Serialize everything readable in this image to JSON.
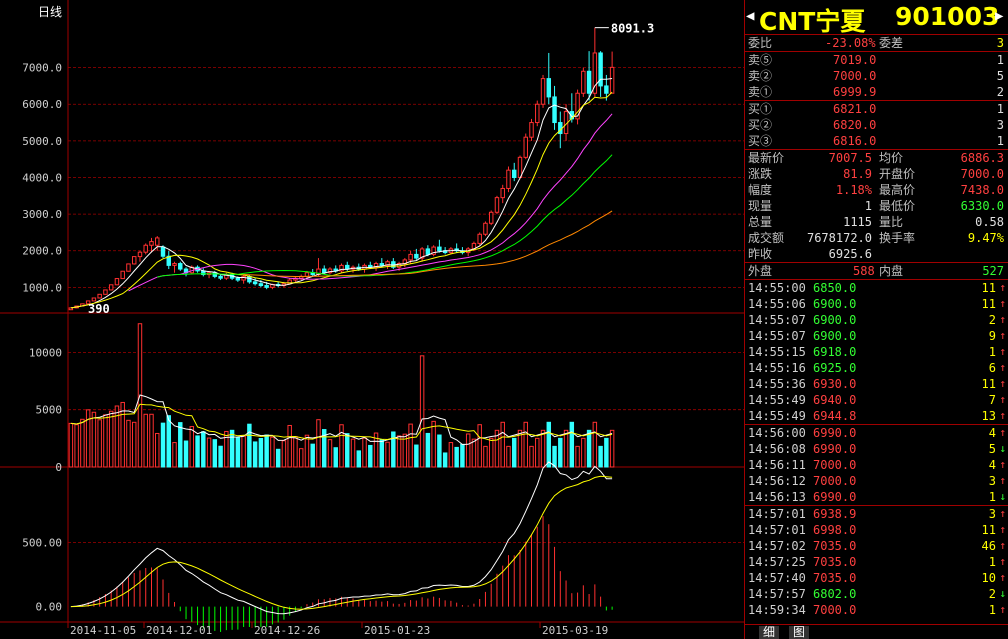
{
  "chart": {
    "period_label": "日线",
    "peak_label": "8091.3",
    "low_label": "390",
    "price_ticks": [
      "7000.0",
      "6000.0",
      "5000.0",
      "4000.0",
      "3000.0",
      "2000.0",
      "1000.0"
    ],
    "vol_ticks": [
      "10000",
      "5000",
      "0"
    ],
    "macd_ticks": [
      "500.00",
      "0.00"
    ],
    "dates": [
      "2014-11-05",
      "2014-12-01",
      "2014-12-26",
      "2015-01-23",
      "2015-03-19"
    ]
  },
  "chart_data": {
    "type": "candlestick",
    "ma_count": 4,
    "colors": {
      "up": "#ff3030",
      "down": "#33ffff",
      "ma1": "#ffffff",
      "ma2": "#ffff00",
      "ma3": "#ff44ff",
      "ma4": "#00ff00",
      "ma5": "#ff8800",
      "grid": "#a00000"
    },
    "candles": [
      [
        0,
        390,
        450,
        380,
        440
      ],
      [
        1,
        440,
        500,
        430,
        490
      ],
      [
        2,
        490,
        560,
        480,
        550
      ],
      [
        3,
        550,
        640,
        540,
        630
      ],
      [
        4,
        630,
        720,
        620,
        710
      ],
      [
        5,
        710,
        820,
        700,
        810
      ],
      [
        6,
        810,
        940,
        800,
        930
      ],
      [
        7,
        930,
        1080,
        920,
        1070
      ],
      [
        8,
        1070,
        1250,
        1060,
        1240
      ],
      [
        9,
        1240,
        1450,
        1230,
        1440
      ],
      [
        10,
        1440,
        1650,
        1430,
        1640
      ],
      [
        11,
        1640,
        1850,
        1620,
        1840
      ],
      [
        12,
        1840,
        2000,
        1700,
        1960
      ],
      [
        13,
        1960,
        2200,
        1900,
        2150
      ],
      [
        14,
        2150,
        2350,
        1950,
        2250
      ],
      [
        15,
        2150,
        2400,
        2000,
        2350
      ],
      [
        16,
        2100,
        2150,
        1800,
        1850
      ],
      [
        17,
        1850,
        2000,
        1500,
        1600
      ],
      [
        18,
        1600,
        1700,
        1400,
        1650
      ],
      [
        19,
        1650,
        1700,
        1450,
        1500
      ],
      [
        20,
        1500,
        1550,
        1300,
        1400
      ],
      [
        21,
        1400,
        1600,
        1350,
        1550
      ],
      [
        22,
        1550,
        1600,
        1400,
        1450
      ],
      [
        23,
        1450,
        1520,
        1300,
        1350
      ],
      [
        24,
        1350,
        1450,
        1250,
        1400
      ],
      [
        25,
        1400,
        1450,
        1250,
        1300
      ],
      [
        26,
        1300,
        1350,
        1200,
        1250
      ],
      [
        27,
        1250,
        1400,
        1200,
        1350
      ],
      [
        28,
        1350,
        1400,
        1200,
        1250
      ],
      [
        29,
        1250,
        1300,
        1150,
        1200
      ],
      [
        30,
        1200,
        1350,
        1100,
        1300
      ],
      [
        31,
        1300,
        1350,
        1100,
        1150
      ],
      [
        32,
        1150,
        1250,
        1050,
        1100
      ],
      [
        33,
        1100,
        1200,
        1000,
        1050
      ],
      [
        34,
        1050,
        1150,
        950,
        1000
      ],
      [
        35,
        1000,
        1100,
        950,
        1080
      ],
      [
        36,
        1080,
        1150,
        1000,
        1050
      ],
      [
        37,
        1050,
        1150,
        1000,
        1100
      ],
      [
        38,
        1100,
        1250,
        1080,
        1200
      ],
      [
        39,
        1200,
        1300,
        1150,
        1250
      ],
      [
        40,
        1250,
        1350,
        1200,
        1300
      ],
      [
        41,
        1300,
        1450,
        1250,
        1400
      ],
      [
        42,
        1400,
        1500,
        1300,
        1350
      ],
      [
        43,
        1350,
        1800,
        1300,
        1500
      ],
      [
        44,
        1500,
        1600,
        1350,
        1400
      ],
      [
        45,
        1400,
        1550,
        1350,
        1500
      ],
      [
        46,
        1500,
        1600,
        1400,
        1450
      ],
      [
        47,
        1450,
        1650,
        1400,
        1600
      ],
      [
        48,
        1600,
        1700,
        1450,
        1500
      ],
      [
        49,
        1500,
        1600,
        1400,
        1550
      ],
      [
        50,
        1550,
        1650,
        1450,
        1500
      ],
      [
        51,
        1500,
        1650,
        1400,
        1600
      ],
      [
        52,
        1600,
        1700,
        1500,
        1550
      ],
      [
        53,
        1550,
        1700,
        1450,
        1650
      ],
      [
        54,
        1650,
        1800,
        1550,
        1600
      ],
      [
        55,
        1600,
        1750,
        1500,
        1700
      ],
      [
        56,
        1700,
        1800,
        1500,
        1550
      ],
      [
        57,
        1550,
        1700,
        1450,
        1650
      ],
      [
        58,
        1650,
        1800,
        1550,
        1750
      ],
      [
        59,
        1750,
        2000,
        1650,
        1900
      ],
      [
        60,
        1900,
        2050,
        1750,
        1800
      ],
      [
        61,
        1800,
        2100,
        1700,
        2050
      ],
      [
        62,
        2050,
        2150,
        1850,
        1900
      ],
      [
        63,
        1900,
        2150,
        1850,
        2100
      ],
      [
        64,
        2100,
        2300,
        1950,
        2000
      ],
      [
        65,
        2000,
        2100,
        1900,
        1950
      ],
      [
        66,
        1950,
        2100,
        1900,
        2050
      ],
      [
        67,
        2050,
        2200,
        1950,
        2000
      ],
      [
        68,
        2000,
        2100,
        1900,
        1950
      ],
      [
        69,
        1950,
        2100,
        1850,
        2050
      ],
      [
        70,
        2050,
        2250,
        2000,
        2200
      ],
      [
        71,
        2200,
        2500,
        2150,
        2450
      ],
      [
        72,
        2450,
        2800,
        2400,
        2750
      ],
      [
        73,
        2750,
        3100,
        2700,
        3050
      ],
      [
        74,
        3050,
        3500,
        3000,
        3450
      ],
      [
        75,
        3450,
        3800,
        3300,
        3700
      ],
      [
        76,
        3700,
        4300,
        3600,
        4200
      ],
      [
        77,
        4200,
        4400,
        3900,
        4000
      ],
      [
        78,
        4000,
        4600,
        3950,
        4550
      ],
      [
        79,
        4550,
        5200,
        4500,
        5100
      ],
      [
        80,
        5100,
        5600,
        5000,
        5500
      ],
      [
        81,
        5500,
        6100,
        5400,
        6000
      ],
      [
        82,
        6000,
        6800,
        5900,
        6700
      ],
      [
        83,
        6700,
        7400,
        6000,
        6200
      ],
      [
        84,
        6200,
        6500,
        5300,
        5500
      ],
      [
        85,
        5500,
        5800,
        4800,
        5200
      ],
      [
        86,
        5200,
        6000,
        5000,
        5800
      ],
      [
        87,
        5800,
        6300,
        5500,
        5600
      ],
      [
        88,
        5600,
        6400,
        5450,
        6300
      ],
      [
        89,
        6300,
        7000,
        6200,
        6900
      ],
      [
        90,
        6900,
        7450,
        6100,
        6300
      ],
      [
        91,
        6300,
        8091,
        6200,
        7400
      ],
      [
        92,
        7400,
        7450,
        6200,
        6500
      ],
      [
        93,
        6500,
        6800,
        6100,
        6300
      ],
      [
        94,
        6300,
        7438,
        6330,
        7007
      ]
    ],
    "price_range": [
      300,
      8300
    ],
    "vol_range": [
      0,
      13000
    ],
    "macd_range": [
      -120,
      1050
    ]
  },
  "side": {
    "name": "CNT宁夏",
    "code": "901003",
    "wei": {
      "l1": "委比",
      "v1": "-23.08%",
      "l2": "委差",
      "v2": "3"
    },
    "sell": [
      {
        "l": "卖⑤",
        "p": "7019.0",
        "v": "1"
      },
      {
        "l": "卖②",
        "p": "7000.0",
        "v": "5"
      },
      {
        "l": "卖①",
        "p": "6999.9",
        "v": "2"
      }
    ],
    "buy": [
      {
        "l": "买①",
        "p": "6821.0",
        "v": "1"
      },
      {
        "l": "买②",
        "p": "6820.0",
        "v": "3"
      },
      {
        "l": "买③",
        "p": "6816.0",
        "v": "1"
      }
    ],
    "quote": [
      {
        "l1": "最新价",
        "v1": "7007.5",
        "c1": "red",
        "l2": "均价",
        "v2": "6886.3",
        "c2": "red"
      },
      {
        "l1": "涨跌",
        "v1": "81.9",
        "c1": "red",
        "l2": "开盘价",
        "v2": "7000.0",
        "c2": "red"
      },
      {
        "l1": "幅度",
        "v1": "1.18%",
        "c1": "red",
        "l2": "最高价",
        "v2": "7438.0",
        "c2": "red"
      },
      {
        "l1": "现量",
        "v1": "1",
        "c1": "wht",
        "l2": "最低价",
        "v2": "6330.0",
        "c2": "grn"
      },
      {
        "l1": "总量",
        "v1": "1115",
        "c1": "wht",
        "l2": "量比",
        "v2": "0.58",
        "c2": "wht"
      },
      {
        "l1": "成交额",
        "v1": "7678172.0",
        "c1": "wht",
        "l2": "换手率",
        "v2": "9.47%",
        "c2": "yel"
      },
      {
        "l1": "昨收",
        "v1": "6925.6",
        "c1": "wht",
        "l2": "",
        "v2": "",
        "c2": "wht"
      }
    ],
    "outer": {
      "l1": "外盘",
      "v1": "588",
      "l2": "内盘",
      "v2": "527"
    },
    "ticks": [
      [
        "14:55:00",
        "6850.0",
        "grn",
        "11",
        "↑",
        "red"
      ],
      [
        "14:55:06",
        "6900.0",
        "grn",
        "11",
        "↑",
        "red"
      ],
      [
        "14:55:07",
        "6900.0",
        "grn",
        "2",
        "↑",
        "red"
      ],
      [
        "14:55:07",
        "6900.0",
        "grn",
        "9",
        "↑",
        "red"
      ],
      [
        "14:55:15",
        "6918.0",
        "grn",
        "1",
        "↑",
        "red"
      ],
      [
        "14:55:16",
        "6925.0",
        "grn",
        "6",
        "↑",
        "red"
      ],
      [
        "14:55:36",
        "6930.0",
        "red",
        "11",
        "↑",
        "red"
      ],
      [
        "14:55:49",
        "6940.0",
        "red",
        "7",
        "↑",
        "red"
      ],
      [
        "14:55:49",
        "6944.8",
        "red",
        "13",
        "↑",
        "red"
      ],
      [
        "14:56:00",
        "6990.0",
        "red",
        "4",
        "↑",
        "red"
      ],
      [
        "14:56:08",
        "6990.0",
        "red",
        "5",
        "↓",
        "grn"
      ],
      [
        "14:56:11",
        "7000.0",
        "red",
        "4",
        "↑",
        "red"
      ],
      [
        "14:56:12",
        "7000.0",
        "red",
        "3",
        "↑",
        "red"
      ],
      [
        "14:56:13",
        "6990.0",
        "red",
        "1",
        "↓",
        "grn"
      ],
      [
        "14:57:01",
        "6938.9",
        "red",
        "3",
        "↑",
        "red"
      ],
      [
        "14:57:01",
        "6998.0",
        "red",
        "11",
        "↑",
        "red"
      ],
      [
        "14:57:02",
        "7035.0",
        "red",
        "46",
        "↑",
        "red"
      ],
      [
        "14:57:25",
        "7035.0",
        "red",
        "1",
        "↑",
        "red"
      ],
      [
        "14:57:40",
        "7035.0",
        "red",
        "10",
        "↑",
        "red"
      ],
      [
        "14:57:57",
        "6802.0",
        "grn",
        "2",
        "↓",
        "grn"
      ],
      [
        "14:59:34",
        "7000.0",
        "red",
        "1",
        "↑",
        "red"
      ]
    ],
    "tabs": [
      "细",
      "图"
    ]
  }
}
